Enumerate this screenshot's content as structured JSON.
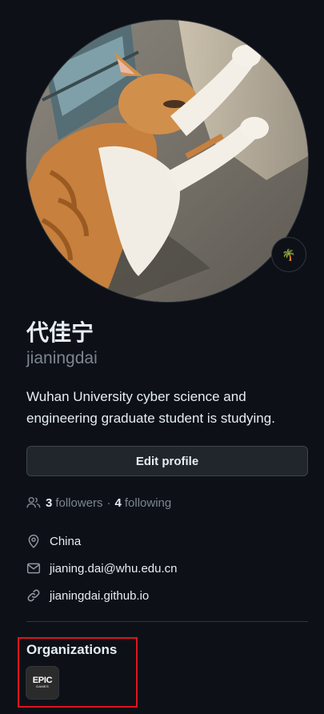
{
  "profile": {
    "display_name": "代佳宁",
    "username": "jianingdai",
    "bio": "Wuhan University cyber science and engineering graduate student is studying.",
    "status_emoji": "🌴",
    "avatar_description_icon": "cat-avatar"
  },
  "actions": {
    "edit_profile_label": "Edit profile"
  },
  "social": {
    "followers_count": "3",
    "followers_label": "followers",
    "separator": "·",
    "following_count": "4",
    "following_label": "following"
  },
  "details": {
    "location": "China",
    "email": "jianing.dai@whu.edu.cn",
    "website": "jianingdai.github.io"
  },
  "organizations": {
    "heading": "Organizations",
    "items": [
      {
        "logo_line1": "EPIC",
        "logo_line2": "GAMES"
      }
    ]
  },
  "colors": {
    "background": "#0d1117",
    "text_primary": "#e6edf3",
    "text_muted": "#7d8590",
    "button_bg": "#21262d",
    "border": "#30363d",
    "highlight": "#e0141f"
  }
}
